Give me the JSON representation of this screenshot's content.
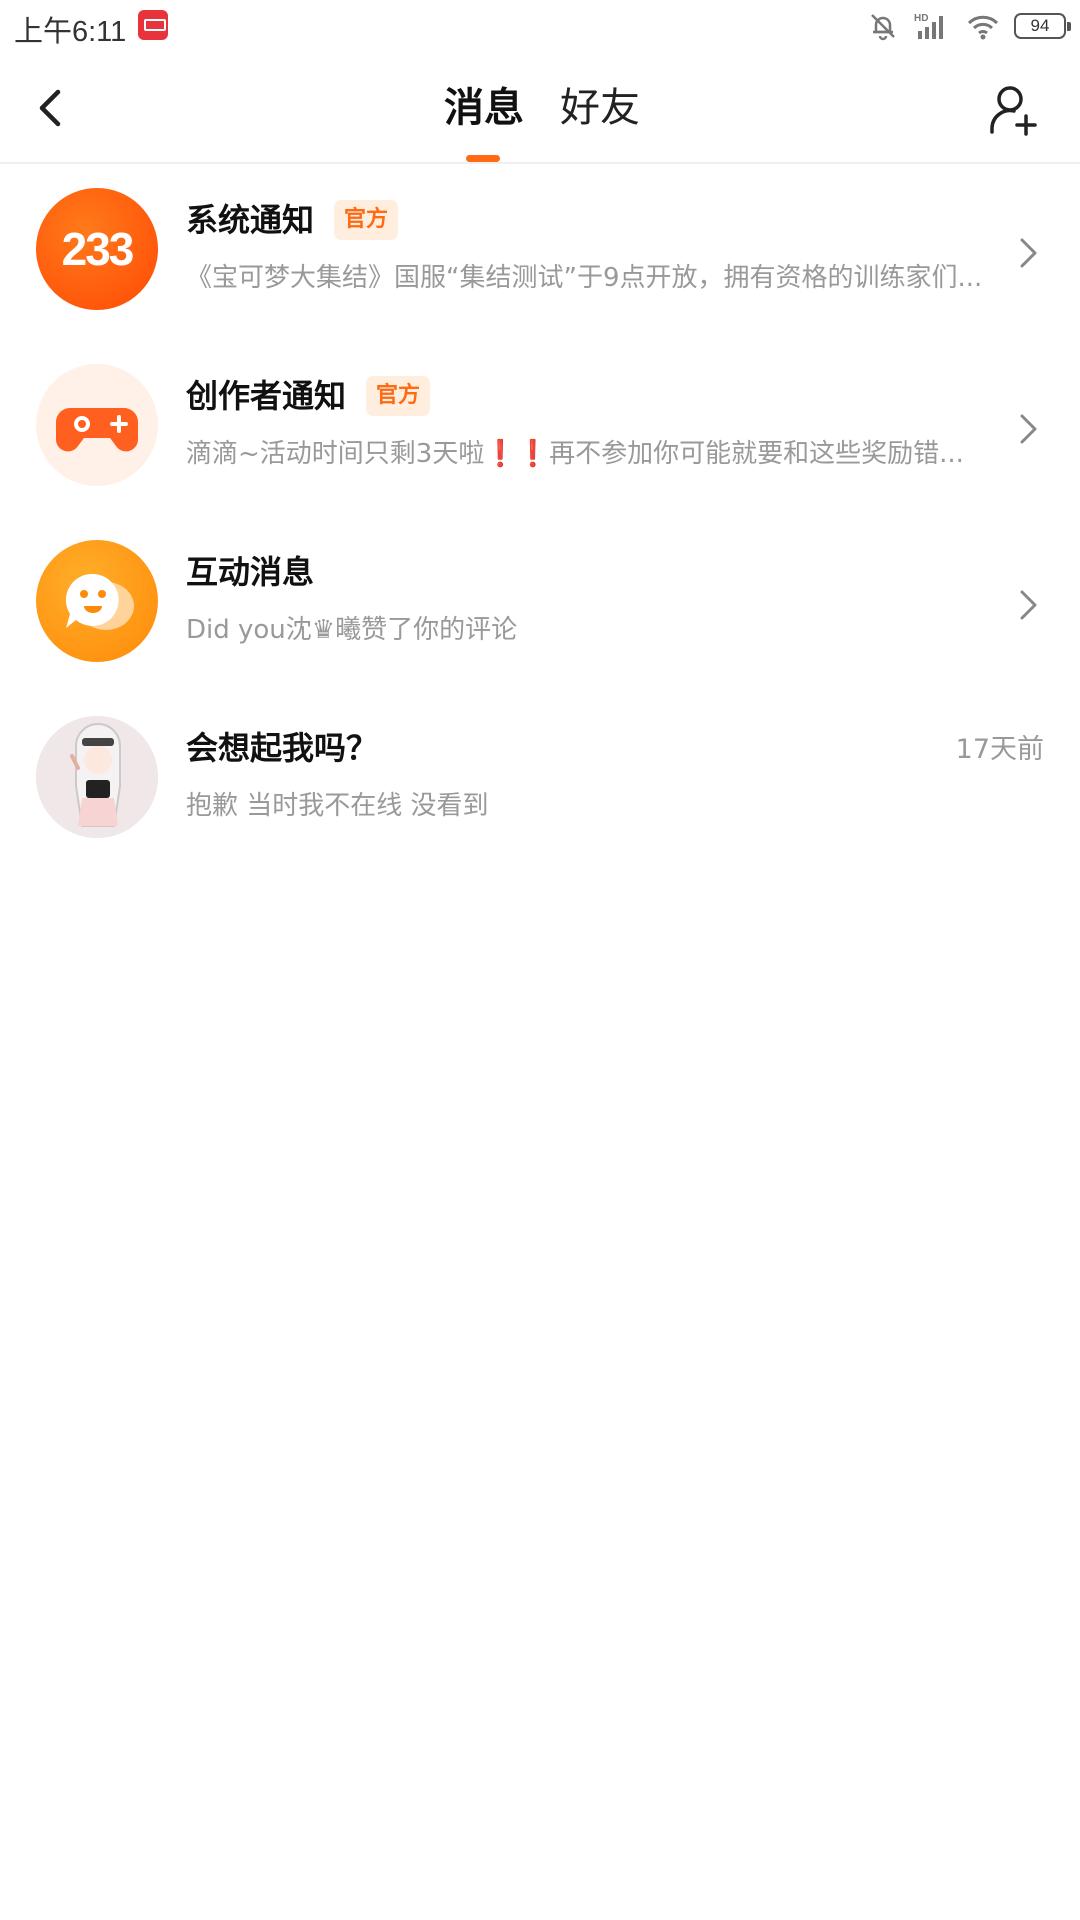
{
  "status_bar": {
    "time": "上午6:11",
    "battery": "94",
    "icons": [
      "app-notification-icon",
      "bell-off-icon",
      "hd-signal-icon",
      "wifi-icon",
      "battery-icon"
    ]
  },
  "header": {
    "back_icon": "back-arrow-icon",
    "tabs": [
      {
        "label": "消息",
        "active": true
      },
      {
        "label": "好友",
        "active": false
      }
    ],
    "add_friend_icon": "add-person-icon",
    "accent": "#ff6a13"
  },
  "messages": [
    {
      "avatar_text": "233",
      "avatar_icon": "system-233-icon",
      "title": "系统通知",
      "badge": "官方",
      "preview": "《宝可梦大集结》国服“集结测试”于9点开放，拥有资格的训练家们...",
      "has_chevron": true
    },
    {
      "avatar_icon": "gamepad-icon",
      "title": "创作者通知",
      "badge": "官方",
      "preview": "滴滴~活动时间只剩3天啦❗❗再不参加你可能就要和这些奖励错...",
      "has_chevron": true
    },
    {
      "avatar_icon": "chat-bubble-face-icon",
      "title": "互动消息",
      "preview": "Did you沈♛曦赞了你的评论",
      "has_chevron": true
    },
    {
      "avatar_icon": "user-avatar-image",
      "title": "会想起我吗？",
      "preview": "抱歉 当时我不在线 没看到",
      "time": "17天前"
    }
  ]
}
